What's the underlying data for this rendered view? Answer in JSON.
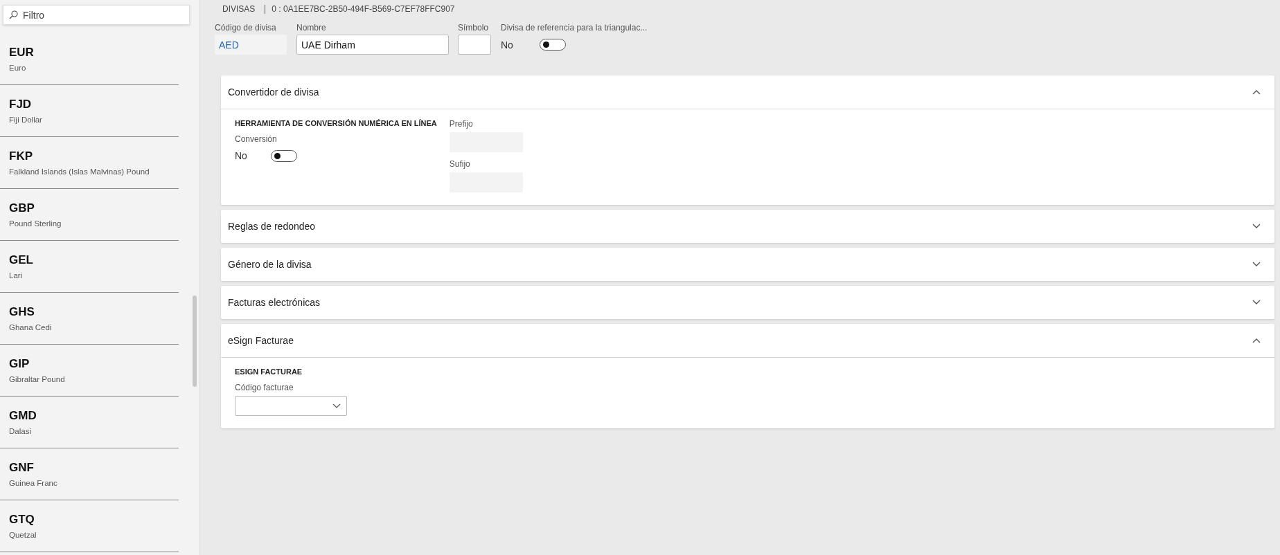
{
  "sidebar": {
    "search": {
      "placeholder": "Filtro"
    },
    "items": [
      {
        "code": "EUR",
        "name": "Euro"
      },
      {
        "code": "FJD",
        "name": "Fiji Dollar"
      },
      {
        "code": "FKP",
        "name": "Falkland Islands (Islas Malvinas) Pound"
      },
      {
        "code": "GBP",
        "name": "Pound Sterling"
      },
      {
        "code": "GEL",
        "name": "Lari"
      },
      {
        "code": "GHS",
        "name": "Ghana Cedi"
      },
      {
        "code": "GIP",
        "name": "Gibraltar Pound"
      },
      {
        "code": "GMD",
        "name": "Dalasi"
      },
      {
        "code": "GNF",
        "name": "Guinea Franc"
      },
      {
        "code": "GTQ",
        "name": "Quetzal"
      }
    ]
  },
  "header": {
    "title": "DIVISAS",
    "record": "0 : 0A1EE7BC-2B50-494F-B569-C7EF78FFC907",
    "fields": [
      {
        "kind": "readonly",
        "label": "Código de divisa",
        "value": "AED"
      },
      {
        "kind": "input",
        "label": "Nombre",
        "value": "UAE Dirham"
      },
      {
        "kind": "input",
        "label": "Símbolo"
      },
      {
        "kind": "toggle",
        "label": "Divisa de referencia para la triangulac...",
        "value": "No",
        "on": false
      }
    ]
  },
  "sections": [
    {
      "title": "Convertidor de divisa",
      "expanded": true,
      "columns": [
        [
          {
            "kind": "heading",
            "label": "HERRAMIENTA DE CONVERSIÓN NUMÉRICA EN LÍNEA"
          },
          {
            "kind": "toggle",
            "label": "Conversión",
            "value": "No",
            "on": false
          }
        ],
        [
          {
            "kind": "readonly",
            "label": "Prefijo"
          },
          {
            "kind": "readonly",
            "label": "Sufijo"
          }
        ]
      ]
    },
    {
      "title": "Reglas de redondeo",
      "expanded": false
    },
    {
      "title": "Género de la divisa",
      "expanded": false
    },
    {
      "title": "Facturas electrónicas",
      "expanded": false
    },
    {
      "title": "eSign Facturae",
      "expanded": true,
      "columns": [
        [
          {
            "kind": "heading",
            "label": "ESIGN FACTURAE"
          },
          {
            "kind": "dropdown",
            "label": "Código facturae"
          }
        ]
      ]
    }
  ]
}
